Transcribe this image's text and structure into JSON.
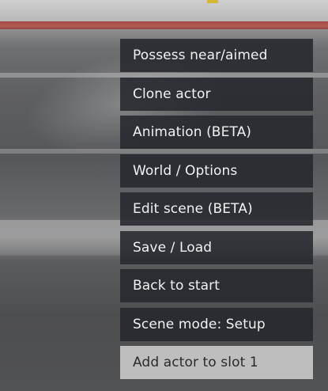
{
  "menu": {
    "items": [
      {
        "label": "Possess near/aimed"
      },
      {
        "label": "Clone actor"
      },
      {
        "label": "Animation (BETA)"
      },
      {
        "label": "World / Options"
      },
      {
        "label": "Edit scene (BETA)"
      },
      {
        "label": "Save / Load"
      },
      {
        "label": "Back to start"
      },
      {
        "label": "Scene mode: Setup"
      },
      {
        "label": "Add actor to slot 1"
      }
    ],
    "selected_index": 8
  },
  "colors": {
    "item_background": "#26282e",
    "item_text": "#f2f2f2",
    "selected_background": "#d7d7d7",
    "selected_text": "#2a2a2a"
  }
}
